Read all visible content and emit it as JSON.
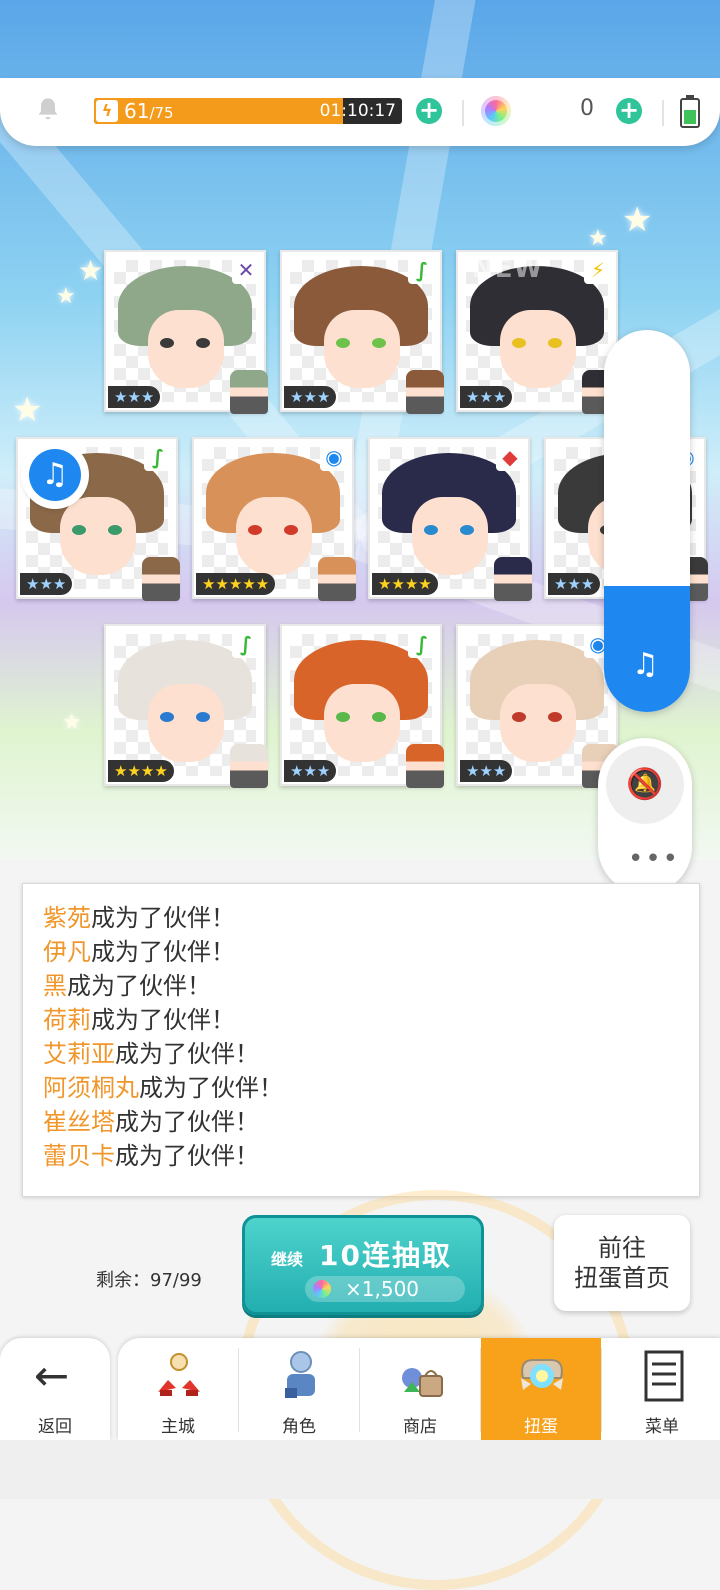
{
  "status_bar": {
    "energy_current": "61",
    "energy_max": "/75",
    "energy_fill_fraction": 0.81,
    "energy_timer": "01:10:17",
    "gem_count": "0"
  },
  "cards": [
    {
      "rarity": "★★★",
      "element": "✕",
      "element_color": "#6b4aa6",
      "new": false
    },
    {
      "rarity": "★★★",
      "element": "∫",
      "element_color": "#3ab83a",
      "new": false
    },
    {
      "rarity": "★★★",
      "element": "⚡",
      "element_color": "#f2c40a",
      "new": true,
      "new_label": "NEW"
    },
    {
      "rarity": "★★★",
      "element": "∫",
      "element_color": "#3ab83a",
      "new": false
    },
    {
      "rarity": "★★★★★",
      "element": "◉",
      "element_color": "#1e88f0",
      "new": false
    },
    {
      "rarity": "★★★★",
      "element": "◆",
      "element_color": "#e03a3a",
      "new": false
    },
    {
      "rarity": "★★★",
      "element": "◉",
      "element_color": "#1e88f0",
      "new": false
    },
    {
      "rarity": "★★★★",
      "element": "∫",
      "element_color": "#3ab83a",
      "new": false
    },
    {
      "rarity": "★★★",
      "element": "∫",
      "element_color": "#3ab83a",
      "new": false
    },
    {
      "rarity": "★★★",
      "element": "◉",
      "element_color": "#1e88f0",
      "new": false
    }
  ],
  "music_panel": {
    "volume_fraction": 0.33,
    "icon": "music-note-icon"
  },
  "log": {
    "lines": [
      {
        "name": "紫苑",
        "suffix": "成为了伙伴！"
      },
      {
        "name": "伊凡",
        "suffix": "成为了伙伴！"
      },
      {
        "name": "黑",
        "suffix": "成为了伙伴！"
      },
      {
        "name": "荷莉",
        "suffix": "成为了伙伴！"
      },
      {
        "name": "艾莉亚",
        "suffix": "成为了伙伴！"
      },
      {
        "name": "阿须桐丸",
        "suffix": "成为了伙伴！"
      },
      {
        "name": "崔丝塔",
        "suffix": "成为了伙伴！"
      },
      {
        "name": "蕾贝卡",
        "suffix": "成为了伙伴！"
      }
    ]
  },
  "actions": {
    "remaining": "剩余：97/99",
    "continue_label": "继续",
    "pull_title": "10连抽取",
    "pull_cost": "×1,500",
    "goto_line1": "前往",
    "goto_line2": "扭蛋首页"
  },
  "nav": {
    "back_label": "返回",
    "items": [
      {
        "label": "主城",
        "active": false
      },
      {
        "label": "角色",
        "active": false
      },
      {
        "label": "商店",
        "active": false
      },
      {
        "label": "扭蛋",
        "active": true
      },
      {
        "label": "菜单",
        "active": false
      }
    ]
  },
  "colors": {
    "accent_orange": "#f8a11b",
    "teal": "#22aeb0",
    "blue": "#1e88f0"
  }
}
